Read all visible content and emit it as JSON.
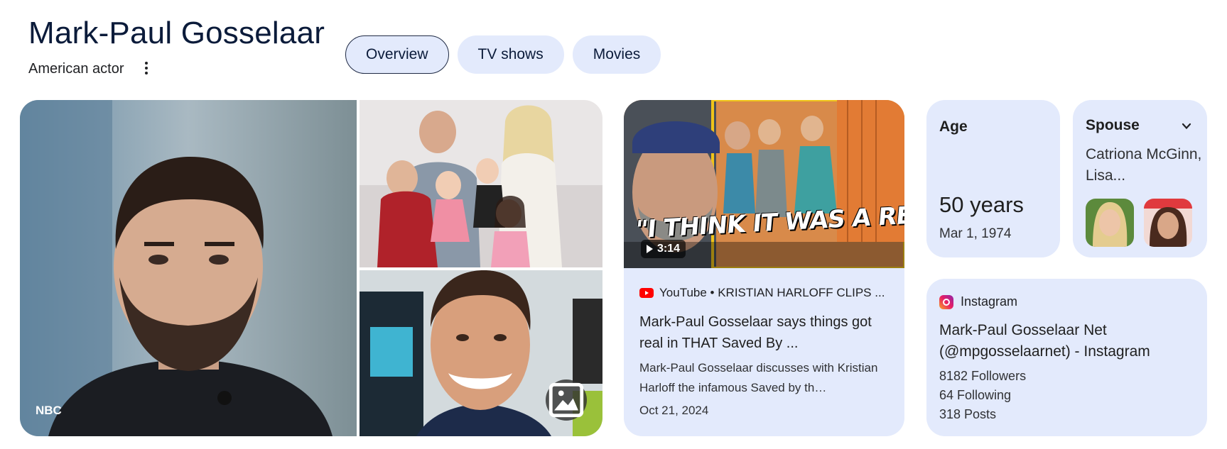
{
  "header": {
    "title": "Mark-Paul Gosselaar",
    "subtitle": "American actor"
  },
  "tabs": [
    {
      "label": "Overview",
      "active": true
    },
    {
      "label": "TV shows",
      "active": false
    },
    {
      "label": "Movies",
      "active": false
    }
  ],
  "gallery": {
    "credit": "NBC",
    "more_images_icon": "image-icon"
  },
  "video": {
    "caption_overlay": "\"I THINK IT WAS A REAL FIGHT.\"",
    "duration": "3:14",
    "source": "YouTube • KRISTIAN HARLOFF CLIPS ...",
    "title": "Mark-Paul Gosselaar says things got real in THAT Saved By ...",
    "description": "Mark-Paul Gosselaar discusses with Kristian Harloff the infamous Saved by th…",
    "date": "Oct 21, 2024"
  },
  "age": {
    "label": "Age",
    "value": "50 years",
    "birth_date": "Mar 1, 1974"
  },
  "spouse": {
    "label": "Spouse",
    "names": "Catriona McGinn, Lisa..."
  },
  "instagram": {
    "source": "Instagram",
    "title": "Mark-Paul Gosselaar Net (@mpgosselaarnet) - Instagram",
    "followers": "8182 Followers",
    "following": "64 Following",
    "posts": "318 Posts"
  },
  "colors": {
    "card_bg": "#e3eafc",
    "title_text": "#0b1b3a",
    "youtube_red": "#ff0000"
  }
}
